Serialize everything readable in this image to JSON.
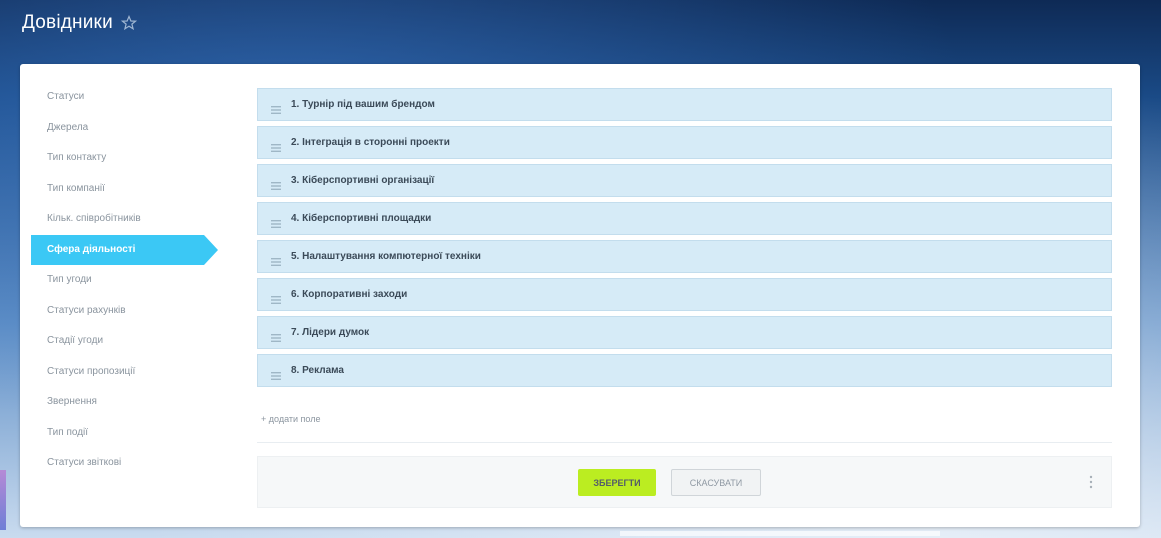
{
  "header": {
    "title": "Довідники",
    "favorite_icon": "star-outline-icon"
  },
  "sidebar": {
    "items": [
      {
        "label": "Статуси",
        "active": false
      },
      {
        "label": "Джерела",
        "active": false
      },
      {
        "label": "Тип контакту",
        "active": false
      },
      {
        "label": "Тип компанії",
        "active": false
      },
      {
        "label": "Кільк. співробітників",
        "active": false
      },
      {
        "label": "Сфера діяльності",
        "active": true
      },
      {
        "label": "Тип угоди",
        "active": false
      },
      {
        "label": "Статуси рахунків",
        "active": false
      },
      {
        "label": "Стадії угоди",
        "active": false
      },
      {
        "label": "Статуси пропозиції",
        "active": false
      },
      {
        "label": "Звернення",
        "active": false
      },
      {
        "label": "Тип події",
        "active": false
      },
      {
        "label": "Статуси звіткові",
        "active": false
      }
    ]
  },
  "list": {
    "rows": [
      {
        "label": "1. Турнір під вашим брендом"
      },
      {
        "label": "2. Інтеграція в сторонні проекти"
      },
      {
        "label": "3. Кіберспортивні організації"
      },
      {
        "label": "4. Кіберспортивні площадки"
      },
      {
        "label": "5. Налаштування компютерної техніки"
      },
      {
        "label": "6. Корпоративні заходи"
      },
      {
        "label": "7. Лідери думок"
      },
      {
        "label": "8. Реклама"
      }
    ],
    "add_field_label": "+ додати поле",
    "drag_icon": "drag-handle-icon"
  },
  "footer": {
    "save_label": "ЗБЕРЕГТИ",
    "cancel_label": "СКАСУВАТИ",
    "more_icon": "more-vertical-icon"
  },
  "colors": {
    "accent": "#3bc8f5",
    "save": "#bbed21",
    "row_bg": "#d6ebf7"
  }
}
